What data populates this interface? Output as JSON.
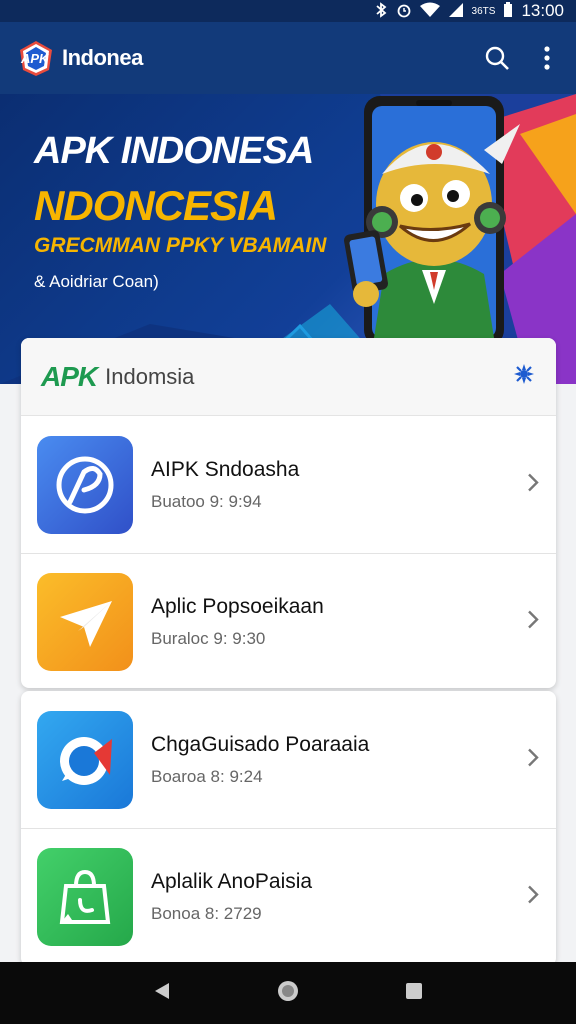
{
  "status_bar": {
    "time": "13:00",
    "network_text": "36TS",
    "icons": [
      "bluetooth-icon",
      "alarm-icon",
      "wifi-icon",
      "signal-icon",
      "battery-icon"
    ]
  },
  "app_bar": {
    "logo_text": "APK",
    "title": "Indonea",
    "actions": [
      "search-icon",
      "more-vert-icon"
    ]
  },
  "hero": {
    "line1": "APK INDONESA",
    "line2": "NDONCESIA",
    "line3": "GRECMMAN PPKY VBAMAIN",
    "line4": "& Aoidriar Coan)"
  },
  "card_header": {
    "brand": "APK",
    "subtitle": "Indomsia",
    "icon": "puzzle-icon"
  },
  "apps": [
    {
      "title": "AIPK Sndoasha",
      "subtitle": "Buatoo 9: 9:94",
      "icon": "edit-circle-icon",
      "color": "#3b6fd8"
    },
    {
      "title": "Aplic Popsoeikaan",
      "subtitle": "Buraloc 9: 9:30",
      "icon": "paper-plane-icon",
      "color": "#f7a21a"
    },
    {
      "title": "ChgaGuisado Poaraaia",
      "subtitle": "Boaroa 8: 9:24",
      "icon": "chat-bubble-icon",
      "color": "#2b9ae8"
    },
    {
      "title": "Aplalik AnoPaisia",
      "subtitle": "Bonoa 8: 2729",
      "icon": "shopping-bag-icon",
      "color": "#2fbf5a"
    }
  ],
  "nav_bar": [
    "back-icon",
    "home-icon",
    "recents-icon"
  ]
}
